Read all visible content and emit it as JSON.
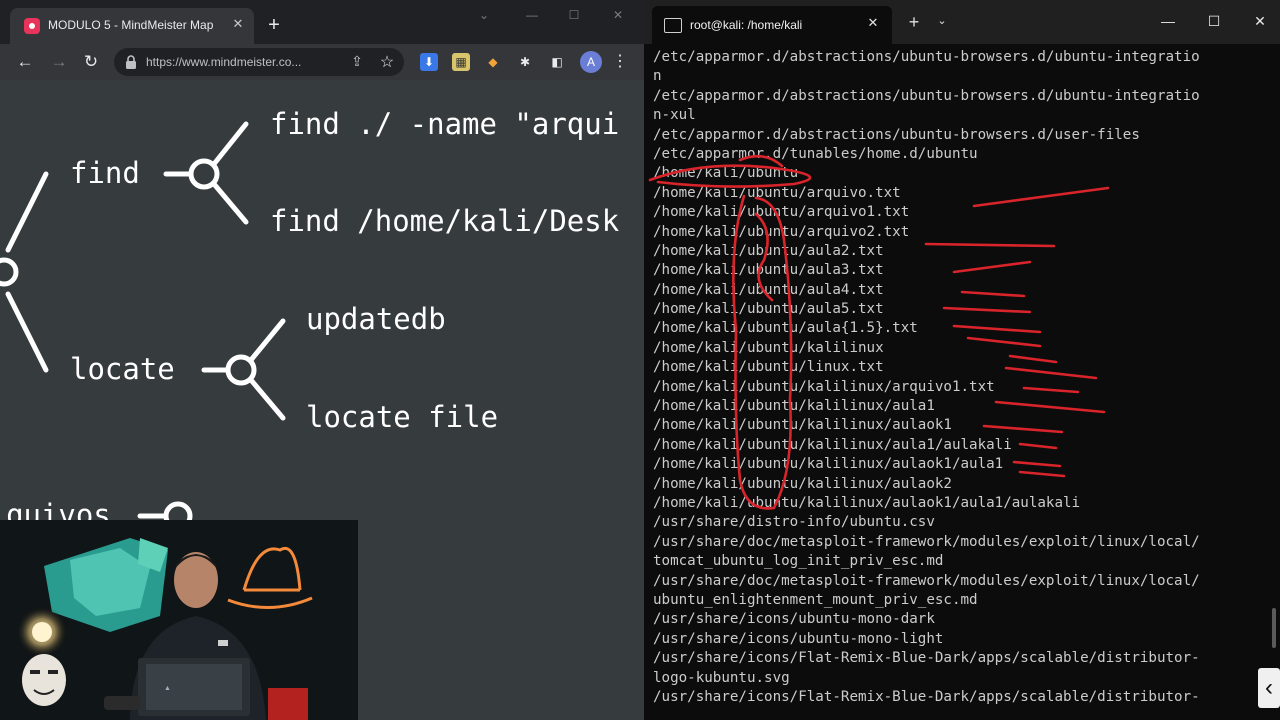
{
  "browser": {
    "tab": {
      "title": "MODULO 5 - MindMeister Map",
      "favicon": "mindmeister-icon"
    },
    "address": {
      "url": "https://www.mindmeister.co..."
    },
    "profile_initial": "A",
    "accent": "#e8335a"
  },
  "mindmap": {
    "left_edge_label": "quivos",
    "branches": [
      {
        "label": "find",
        "children": [
          "find ./ -name \"arqui",
          "find /home/kali/Desk"
        ]
      },
      {
        "label": "locate",
        "children": [
          "updatedb",
          "locate file"
        ]
      }
    ],
    "background": "#363b3d",
    "line_color": "#ffffff"
  },
  "terminal": {
    "tab_title": "root@kali: /home/kali",
    "lines": [
      "/etc/apparmor.d/abstractions/ubuntu-browsers.d/ubuntu-integratio",
      "n",
      "/etc/apparmor.d/abstractions/ubuntu-browsers.d/ubuntu-integratio",
      "n-xul",
      "/etc/apparmor.d/abstractions/ubuntu-browsers.d/user-files",
      "/etc/apparmor.d/tunables/home.d/ubuntu",
      "/home/kali/ubuntu",
      "/home/kali/ubuntu/arquivo.txt",
      "/home/kali/ubuntu/arquivo1.txt",
      "/home/kali/ubuntu/arquivo2.txt",
      "/home/kali/ubuntu/aula2.txt",
      "/home/kali/ubuntu/aula3.txt",
      "/home/kali/ubuntu/aula4.txt",
      "/home/kali/ubuntu/aula5.txt",
      "/home/kali/ubuntu/aula{1.5}.txt",
      "/home/kali/ubuntu/kalilinux",
      "/home/kali/ubuntu/linux.txt",
      "/home/kali/ubuntu/kalilinux/arquivo1.txt",
      "/home/kali/ubuntu/kalilinux/aula1",
      "/home/kali/ubuntu/kalilinux/aulaok1",
      "/home/kali/ubuntu/kalilinux/aula1/aulakali",
      "/home/kali/ubuntu/kalilinux/aulaok1/aula1",
      "/home/kali/ubuntu/kalilinux/aulaok2",
      "/home/kali/ubuntu/kalilinux/aulaok1/aula1/aulakali",
      "/usr/share/distro-info/ubuntu.csv",
      "/usr/share/doc/metasploit-framework/modules/exploit/linux/local/",
      "tomcat_ubuntu_log_init_priv_esc.md",
      "/usr/share/doc/metasploit-framework/modules/exploit/linux/local/",
      "ubuntu_enlightenment_mount_priv_esc.md",
      "/usr/share/icons/ubuntu-mono-dark",
      "/usr/share/icons/ubuntu-mono-light",
      "/usr/share/icons/Flat-Remix-Blue-Dark/apps/scalable/distributor-",
      "logo-kubuntu.svg",
      "/usr/share/icons/Flat-Remix-Blue-Dark/apps/scalable/distributor-"
    ],
    "annotation_color": "#d8242a",
    "background": "#0c0c0c",
    "text_color": "#cccccc"
  }
}
